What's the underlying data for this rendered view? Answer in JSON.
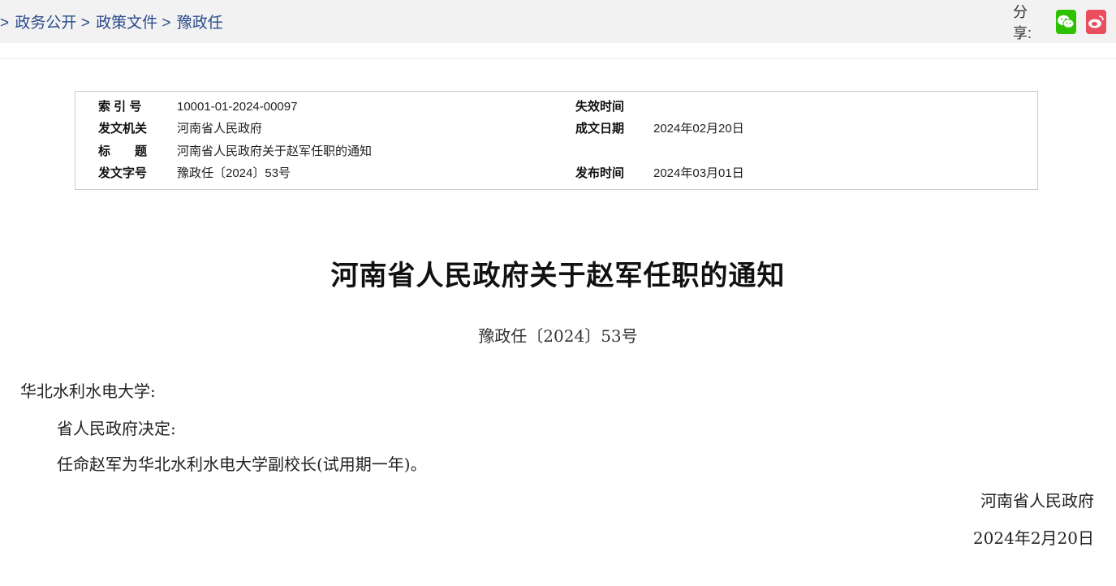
{
  "breadcrumb": {
    "items": [
      "政务公开",
      "政策文件",
      "豫政任"
    ],
    "separator": ">"
  },
  "share": {
    "label": "分享:",
    "buttons": [
      {
        "icon": "wechat-icon",
        "color": "#2dc100"
      },
      {
        "icon": "weibo-icon",
        "color": "#e6162d"
      }
    ]
  },
  "meta": {
    "index_label": "索 引 号",
    "index_value": "10001-01-2024-00097",
    "expiry_label": "失效时间",
    "expiry_value": "",
    "issuer_label": "发文机关",
    "issuer_value": "河南省人民政府",
    "written_label": "成文日期",
    "written_value": "2024年02月20日",
    "title_label": "标　　题",
    "title_value": "河南省人民政府关于赵军任职的通知",
    "docno_label": "发文字号",
    "docno_value": "豫政任〔2024〕53号",
    "publish_label": "发布时间",
    "publish_value": "2024年03月01日"
  },
  "document": {
    "title": "河南省人民政府关于赵军任职的通知",
    "number": "豫政任〔2024〕53号",
    "recipient": "华北水利水电大学:",
    "para1": "省人民政府决定:",
    "para2": "任命赵军为华北水利水电大学副校长(试用期一年)。",
    "signer": "河南省人民政府",
    "date": "2024年2月20日"
  }
}
